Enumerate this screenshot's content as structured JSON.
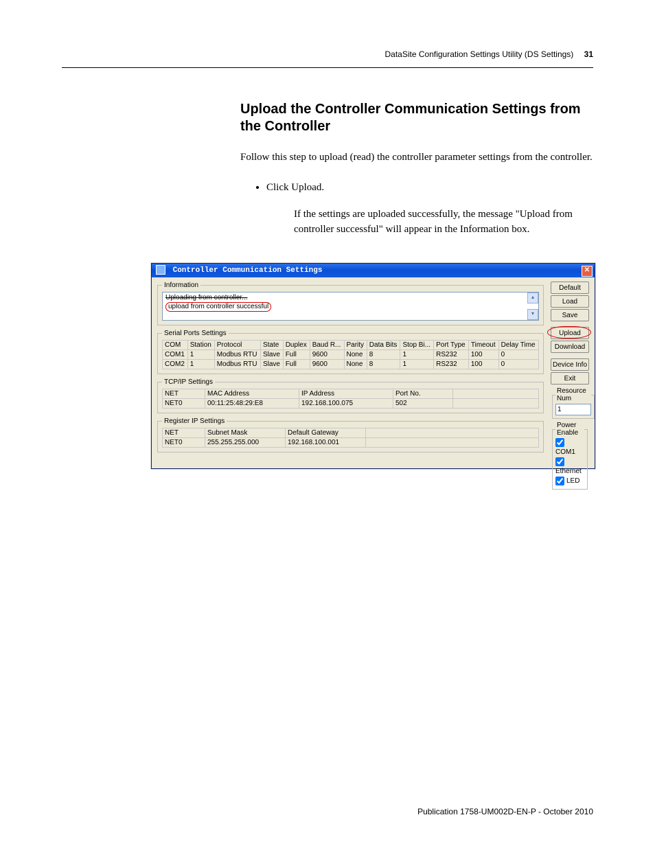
{
  "header": {
    "title": "DataSite Configuration Settings Utility (DS Settings)",
    "page": "31"
  },
  "section": {
    "title": "Upload the Controller Communication Settings from the Controller",
    "intro": "Follow this step to upload (read) the controller parameter settings from the controller.",
    "bullet": "Click Upload.",
    "result": "If the settings are uploaded successfully, the message \"Upload from controller successful\" will appear in the Information box."
  },
  "dialog": {
    "title": "Controller Communication Settings",
    "info_legend": "Information",
    "info_line1": "Uploading from controller...",
    "info_line2": "upload from controller successful",
    "serial_legend": "Serial Ports Settings",
    "serial_headers": [
      "COM",
      "Station",
      "Protocol",
      "State",
      "Duplex",
      "Baud R...",
      "Parity",
      "Data Bits",
      "Stop Bi...",
      "Port Type",
      "Timeout",
      "Delay Time"
    ],
    "serial_rows": [
      [
        "COM1",
        "1",
        "Modbus RTU",
        "Slave",
        "Full",
        "9600",
        "None",
        "8",
        "1",
        "RS232",
        "100",
        "0"
      ],
      [
        "COM2",
        "1",
        "Modbus RTU",
        "Slave",
        "Full",
        "9600",
        "None",
        "8",
        "1",
        "RS232",
        "100",
        "0"
      ]
    ],
    "tcpip_legend": "TCP/IP Settings",
    "tcpip_headers": [
      "NET",
      "MAC Address",
      "IP Address",
      "Port No."
    ],
    "tcpip_row": [
      "NET0",
      "00:11:25:48:29:E8",
      "192.168.100.075",
      "502"
    ],
    "regip_legend": "Register IP Settings",
    "regip_headers": [
      "NET",
      "Subnet Mask",
      "Default Gateway"
    ],
    "regip_row": [
      "NET0",
      "255.255.255.000",
      "192.168.100.001"
    ],
    "buttons": {
      "default": "Default",
      "load": "Load",
      "save": "Save",
      "upload": "Upload",
      "download": "Download",
      "deviceinfo": "Device Info",
      "exit": "Exit"
    },
    "resource_legend": "Resource Num",
    "resource_value": "1",
    "power_legend": "Power Enable",
    "power_com1": "COM1",
    "power_eth": "Ethernet",
    "power_led": "LED"
  },
  "footer": "Publication 1758-UM002D-EN-P - October 2010"
}
